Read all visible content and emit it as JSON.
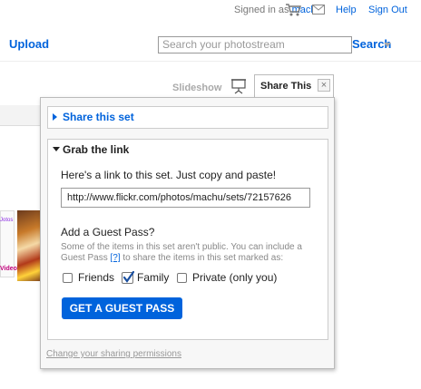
{
  "header": {
    "signed_in_prefix": "Signed in as ",
    "username": "machu",
    "username_suffix": ".",
    "help": "Help",
    "sign_out": "Sign Out",
    "upload": "Upload",
    "search_placeholder": "Search your photostream",
    "search_button": "Search"
  },
  "tabs": {
    "slideshow": "Slideshow",
    "share": "Share This",
    "close": "×"
  },
  "background": {
    "link1": "Jotos",
    "link2": "Video:"
  },
  "panel": {
    "share_set": "Share this set",
    "grab_link": "Grab the link",
    "copy_text": "Here's a link to this set. Just copy and paste!",
    "link_value": "http://www.flickr.com/photos/machu/sets/72157626",
    "guest_question": "Add a Guest Pass?",
    "guest_desc_1": "Some of the items in this set aren't public. You can include a Guest Pass ",
    "guest_desc_help": "[?]",
    "guest_desc_2": " to share the items in this set marked as:",
    "options": [
      {
        "label": "Friends",
        "checked": false
      },
      {
        "label": "Family",
        "checked": true
      },
      {
        "label": "Private (only you)",
        "checked": false
      }
    ],
    "guest_button": "GET A GUEST PASS",
    "change_permissions": "Change your sharing permissions"
  },
  "colors": {
    "link": "#0063dc",
    "button": "#0063dc"
  }
}
